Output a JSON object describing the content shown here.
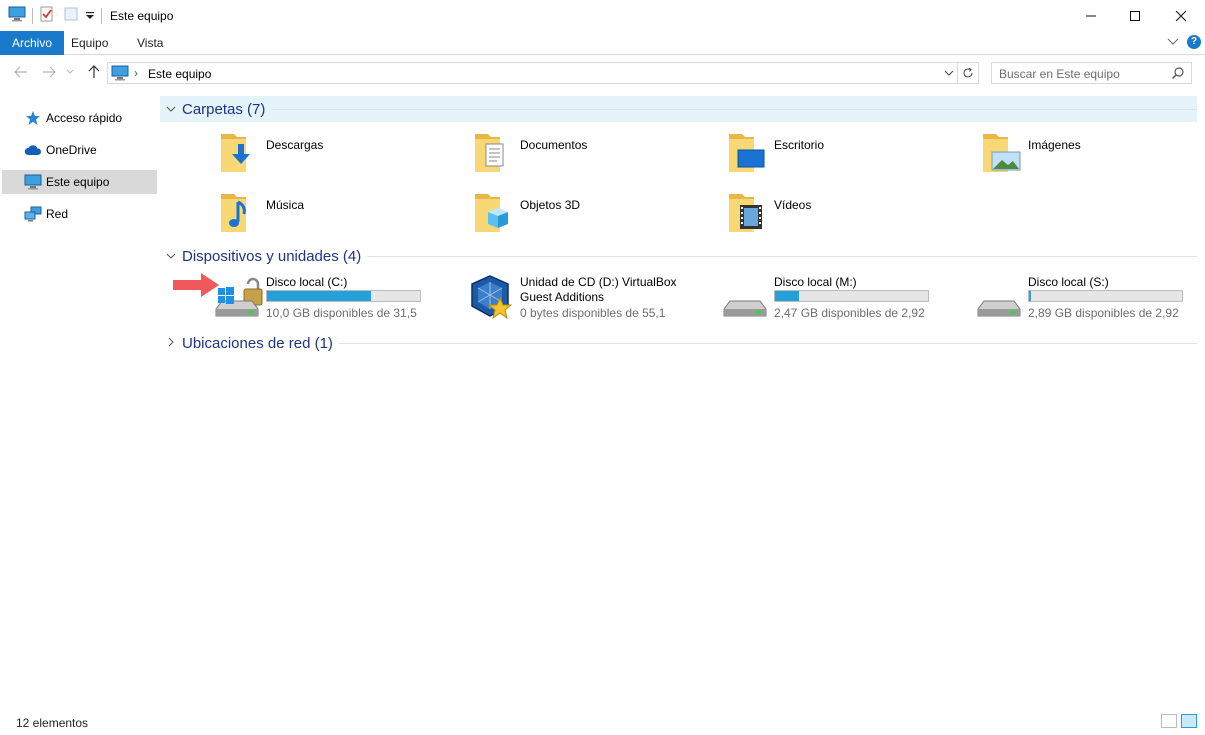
{
  "window": {
    "title": "Este equipo"
  },
  "ribbon": {
    "tabs": [
      "Archivo",
      "Equipo",
      "Vista"
    ],
    "help": "?"
  },
  "address": {
    "path": "Este equipo",
    "separator": "›"
  },
  "search": {
    "placeholder": "Buscar en Este equipo"
  },
  "sidebar": {
    "items": [
      {
        "label": "Acceso rápido",
        "icon": "star-icon"
      },
      {
        "label": "OneDrive",
        "icon": "cloud-icon"
      },
      {
        "label": "Este equipo",
        "icon": "computer-icon",
        "selected": true
      },
      {
        "label": "Red",
        "icon": "network-icon"
      }
    ]
  },
  "groups": {
    "folders_title": "Carpetas (7)",
    "devices_title": "Dispositivos y unidades (4)",
    "network_title": "Ubicaciones de red (1)"
  },
  "folders": [
    {
      "name": "Descargas",
      "overlay": "download-arrow"
    },
    {
      "name": "Documentos",
      "overlay": "document"
    },
    {
      "name": "Escritorio",
      "overlay": "desktop"
    },
    {
      "name": "Imágenes",
      "overlay": "picture"
    },
    {
      "name": "Música",
      "overlay": "music-note"
    },
    {
      "name": "Objetos 3D",
      "overlay": "cube"
    },
    {
      "name": "Vídeos",
      "overlay": "film"
    }
  ],
  "drives": [
    {
      "name": "Disco local (C:)",
      "free": "10,0 GB disponibles de 31,5",
      "used_fraction": 0.68,
      "icon": "windows-drive-icon"
    },
    {
      "name_line1": "Unidad de CD (D:) VirtualBox",
      "name_line2": "Guest Additions",
      "free": "0 bytes disponibles de 55,1",
      "icon": "virtualbox-cd-icon"
    },
    {
      "name": "Disco local (M:)",
      "free": "2,47 GB disponibles de 2,92",
      "used_fraction": 0.155,
      "icon": "drive-icon"
    },
    {
      "name": "Disco local (S:)",
      "free": "2,89 GB disponibles de 2,92",
      "used_fraction": 0.01,
      "icon": "drive-icon"
    }
  ],
  "status": {
    "count": "12 elementos"
  },
  "colors": {
    "accent": "#1979ca",
    "bar_fill": "#26a0da",
    "group_title": "#1e3287",
    "highlight": "#e5f3fb",
    "arrow": "#f0585c"
  }
}
